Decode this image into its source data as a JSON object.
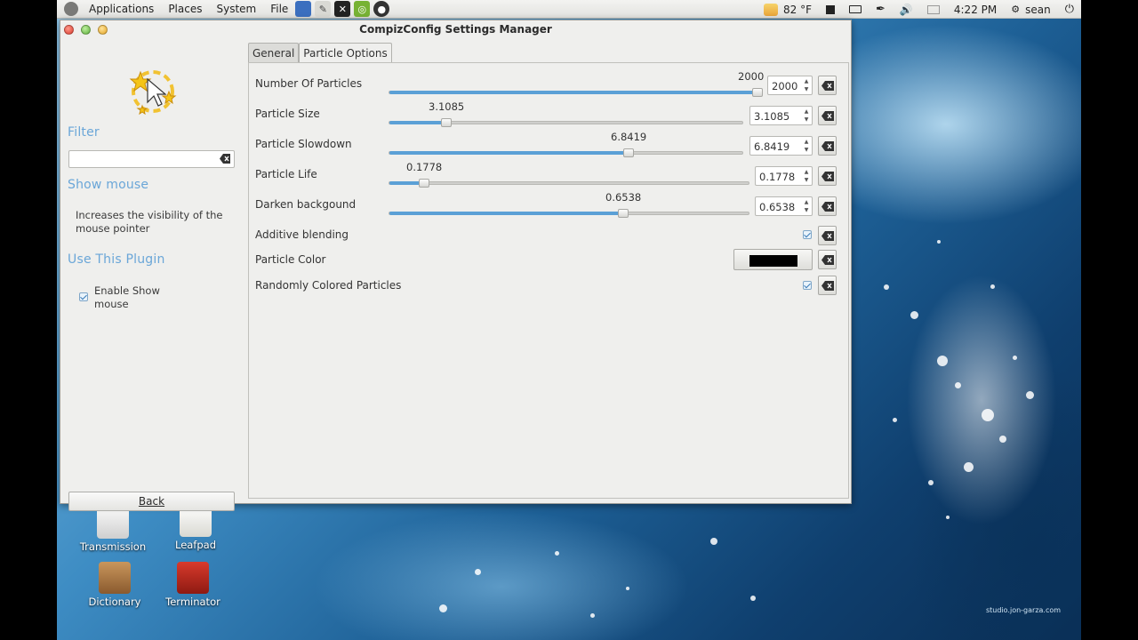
{
  "top_panel": {
    "menus": [
      "Applications",
      "Places",
      "System",
      "File"
    ],
    "weather": "82 °F",
    "clock": "4:22 PM",
    "user": "sean"
  },
  "window": {
    "title": "CompizConfig Settings Manager"
  },
  "left_panel": {
    "filter_heading": "Filter",
    "filter_value": "",
    "plugin_heading": "Show mouse",
    "plugin_description": "Increases the visibility of the mouse pointer",
    "use_heading": "Use This Plugin",
    "enable_label": "Enable Show mouse",
    "enable_checked": true,
    "back_label": "Back"
  },
  "tabs": [
    {
      "label": "General",
      "active": false
    },
    {
      "label": "Particle Options",
      "active": true
    }
  ],
  "settings": [
    {
      "label": "Number Of Particles",
      "value": "2000",
      "fraction": 1.0
    },
    {
      "label": "Particle Size",
      "value": "3.1085",
      "fraction": 0.16
    },
    {
      "label": "Particle Slowdown",
      "value": "6.8419",
      "fraction": 0.675
    },
    {
      "label": "Particle Life",
      "value": "0.1778",
      "fraction": 0.095
    },
    {
      "label": "Darken backgound",
      "value": "0.6538",
      "fraction": 0.65
    },
    {
      "label": "Additive blending",
      "checked": true
    },
    {
      "label": "Particle Color",
      "color": "#000000"
    },
    {
      "label": "Randomly Colored Particles",
      "checked": true
    }
  ],
  "desktop_icons": [
    "Transmission",
    "Leafpad",
    "Dictionary",
    "Terminator"
  ],
  "wallpaper_credit": "studio.jon-garza.com",
  "colors": {
    "accent": "#6aa6d8",
    "slider_fill": "#5ba0d6"
  }
}
